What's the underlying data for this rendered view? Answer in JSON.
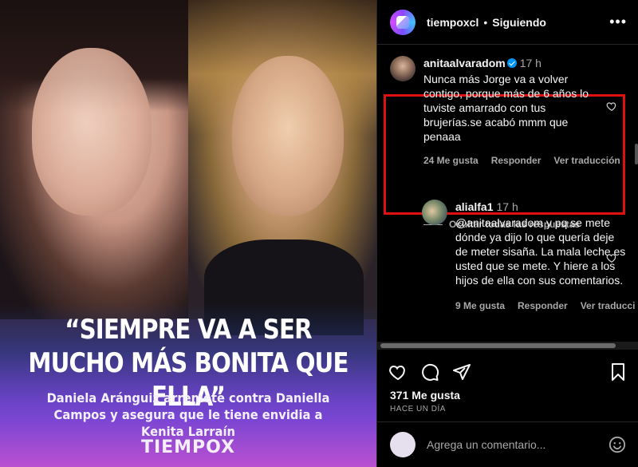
{
  "post": {
    "headline": "“SIEMPRE VA A SER MUCHO MÁS BONITA QUE ELLA”",
    "subheadline": "Daniela Aránguiz arremete contra Daniella Campos y asegura que le tiene envidia a Kenita Larraín",
    "brand": "TIEMPOX"
  },
  "header": {
    "username": "tiempoxcl",
    "separator": "•",
    "follow_state": "Siguiendo",
    "more": "•••"
  },
  "comments": [
    {
      "username": "anitaalvaradom",
      "verified": true,
      "time": "17 h",
      "text": "Nunca más Jorge va a volver contigo, porque más de 6 años lo tuviste amarrado con tus brujerías.se acabó mmm que penaaa",
      "likes": "24 Me gusta",
      "reply": "Responder",
      "translate": "Ver traducción"
    }
  ],
  "replies_toggle": "Ocultar todas las respuestas",
  "replies": [
    {
      "username": "alialfa1",
      "time": "17 h",
      "text": "@anitaalvaradom y pq se mete dónde ya dijo lo que quería deje de meter sisaña. La mala leche es usted que se mete. Y hiere a los hijos de ella con sus comentarios.",
      "likes": "9 Me gusta",
      "reply": "Responder",
      "translate": "Ver traducci"
    }
  ],
  "stats": {
    "likes": "371 Me gusta",
    "time_ago": "HACE UN DÍA"
  },
  "composer": {
    "placeholder": "Agrega un comentario..."
  },
  "icons": [
    "heart-icon",
    "comment-icon",
    "share-icon",
    "bookmark-icon",
    "emoji-icon",
    "more-icon",
    "verified-icon"
  ],
  "colors": {
    "highlight": "#e01010",
    "verified": "#0095f6",
    "muted": "#a8a8a8"
  }
}
